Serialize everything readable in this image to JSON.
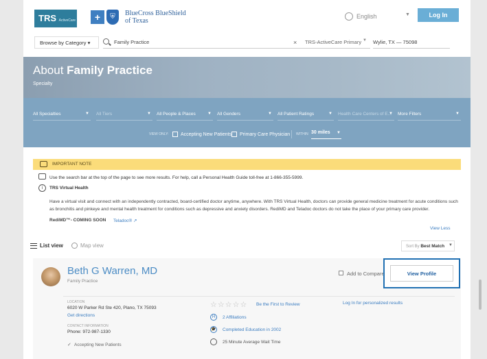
{
  "header": {
    "trs_logo": "TRS",
    "trs_logo_sub": "ActiveCare",
    "bcbs_name_line1": "BlueCross BlueShield",
    "bcbs_name_line2": "of Texas",
    "language": "English",
    "login_label": "Log In"
  },
  "search": {
    "browse_label": "Browse by Category",
    "query": "Family Practice",
    "clear_label": "×",
    "plan": "TRS-ActiveCare Primary",
    "location": "Wylie, TX — 75098"
  },
  "hero": {
    "title_prefix": "About ",
    "title_bold": "Family Practice",
    "subtitle": "Specialty"
  },
  "filters": {
    "selects": [
      {
        "label": "All Specialties",
        "dim": false
      },
      {
        "label": "All Tiers",
        "dim": true
      },
      {
        "label": "All People & Places",
        "dim": false
      },
      {
        "label": "All Genders",
        "dim": false
      },
      {
        "label": "All Patient Ratings",
        "dim": false
      },
      {
        "label": "Health Care Centers of E...",
        "dim": true
      }
    ],
    "more_label": "More Filters",
    "view_only_label": "VIEW ONLY:",
    "accepting_label": "Accepting New Patients",
    "pcp_label": "Primary Care Physician",
    "within_label": "WITHIN",
    "miles": "30 miles"
  },
  "notes": {
    "important_label": "IMPORTANT NOTE",
    "help_text": "Use the search bar at the top of the page to see more results. For help, call a Personal Health Guide toll-free at 1-866-355-5999.",
    "vh_title": "TRS Virtual Health",
    "vh_body": "Have a virtual visit and connect with an independently contracted, board-certified doctor anytime, anywhere. With TRS Virtual Health, doctors can provide general medicine treatment for acute conditions such as bronchitis and pinkeye and mental health treatment for conditions such as depressive and anxiety disorders. RediMD and Teladoc doctors do not take the place of your primary care provider.",
    "redimd_label": "RediMD™- COMING SOON",
    "teladoc_label": "Teladoc®",
    "view_less": "View Less"
  },
  "list_controls": {
    "list_view": "List view",
    "map_view": "Map view",
    "sort_prefix": "Sort By",
    "sort_value": "Best Match"
  },
  "provider": {
    "name": "Beth G Warren, MD",
    "specialty": "Family Practice",
    "compare_label": "Add to Compare",
    "view_profile": "View Profile",
    "location_label": "LOCATION",
    "address": "6020 W Parker Rd Ste 420, Plano, TX 75093",
    "directions": "Get directions",
    "contact_label": "CONTACT INFORMATION",
    "phone": "Phone: 972-987-1330",
    "accepting": "Accepting New Patients",
    "review_link": "Be the First to Review",
    "affiliations": "2 Affiliations",
    "education": "Completed Education in 2002",
    "wait_time": "25 Minute Average Wait Time",
    "personalized": "Log In for personalized results"
  }
}
